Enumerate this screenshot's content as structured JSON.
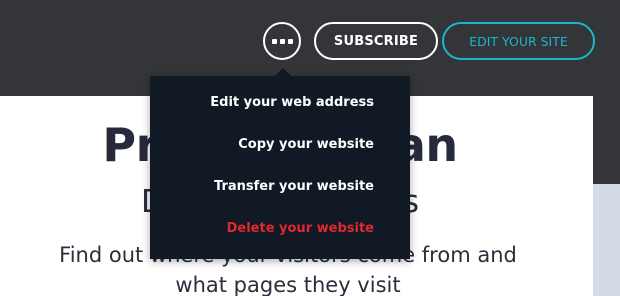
{
  "header": {
    "more_icon": "more-horizontal-icon",
    "subscribe_label": "SUBSCRIBE",
    "edit_site_label": "EDIT YOUR SITE",
    "accent_color": "#18b7cc"
  },
  "menu": {
    "items": [
      {
        "label": "Edit your web address"
      },
      {
        "label": "Copy your website"
      },
      {
        "label": "Transfer your website"
      },
      {
        "label": "Delete your website",
        "danger_color": "#e0292e"
      }
    ]
  },
  "page": {
    "heading": "Premium Plan",
    "subheading": "Detailed statistics",
    "description": "Find out where your visitors come from and what pages they visit"
  }
}
